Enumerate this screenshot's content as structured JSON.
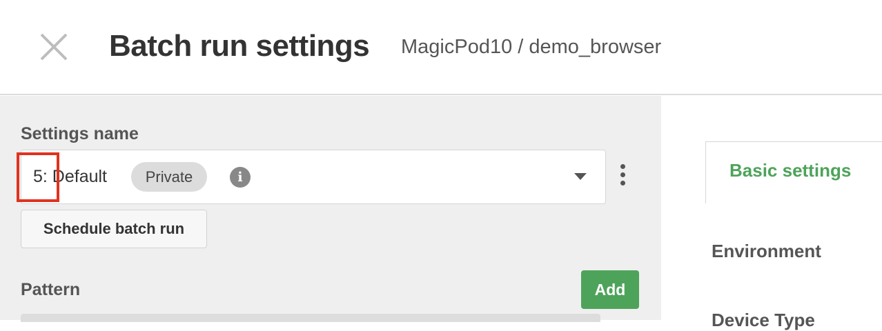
{
  "header": {
    "title": "Batch run settings",
    "breadcrumb": "MagicPod10 / demo_browser"
  },
  "settings": {
    "label": "Settings name",
    "selected_value": "5: Default",
    "visibility_badge": "Private",
    "info_icon": "i"
  },
  "buttons": {
    "schedule_label": "Schedule batch run",
    "add_label": "Add"
  },
  "pattern": {
    "label": "Pattern"
  },
  "right_panel": {
    "tab_label": "Basic settings",
    "environment_label": "Environment",
    "device_type_label": "Device Type"
  },
  "colors": {
    "accent_green": "#4ea35a",
    "highlight_red": "#e0321f",
    "panel_gray": "#efefef"
  }
}
